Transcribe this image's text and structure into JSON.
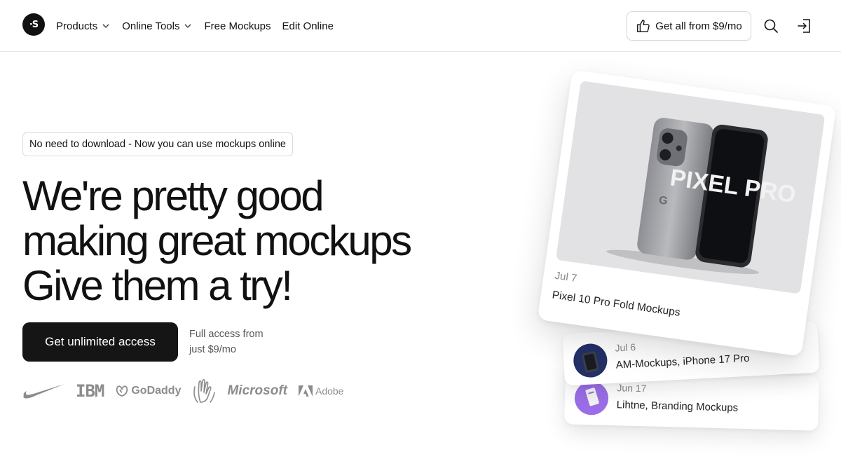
{
  "header": {
    "logo_text": "·S",
    "nav": [
      {
        "label": "Products",
        "has_dropdown": true
      },
      {
        "label": "Online Tools",
        "has_dropdown": true
      },
      {
        "label": "Free Mockups",
        "has_dropdown": false
      },
      {
        "label": "Edit Online",
        "has_dropdown": false
      }
    ],
    "cta_label": "Get all from $9/mo",
    "cta_icon": "thumbs-up-icon",
    "search_icon": "search-icon",
    "login_icon": "login-icon"
  },
  "hero": {
    "badge": "No need to download - Now you can use mockups online",
    "headline": [
      "We're pretty good",
      "making great mockups",
      "Give them a try!"
    ],
    "primary_button": "Get unlimited access",
    "price_note_line1": "Full access from",
    "price_note_line2": "just $9/mo",
    "logos": [
      "Nike",
      "IBM",
      "GoDaddy",
      "Hands",
      "Microsoft",
      "Adobe"
    ]
  },
  "brand_text": {
    "ibm": "IBM",
    "godaddy": "GoDaddy",
    "microsoft": "Microsoft",
    "adobe": "Adobe"
  },
  "cards": {
    "main": {
      "date": "Jul 7",
      "title": "Pixel 10 Pro Fold Mockups",
      "phone_text": "PIXEL PRO"
    },
    "second": {
      "date": "Jul 6",
      "title": "AM-Mockups, iPhone 17 Pro"
    },
    "third": {
      "date": "Jun 17",
      "title": "Lihtne, Branding Mockups"
    }
  },
  "colors": {
    "text": "#111111",
    "button_dark": "#151515",
    "muted": "#8a8a8a",
    "border": "#dcdcdc",
    "thumb_blue": "#1f2b5c",
    "thumb_purple": "#9b6ee8"
  }
}
